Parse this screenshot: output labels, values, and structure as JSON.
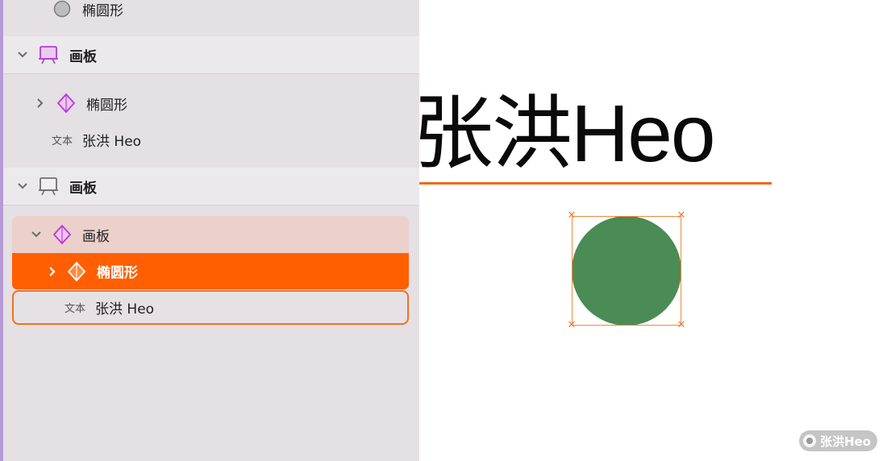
{
  "layers": {
    "top_item": {
      "label": "椭圆形"
    },
    "group1": {
      "label": "画板",
      "children": [
        {
          "label": "椭圆形"
        },
        {
          "type_tag": "文本",
          "label": "张洪 Heo"
        }
      ]
    },
    "group2": {
      "label": "画板",
      "children": [
        {
          "label": "画板"
        },
        {
          "label": "椭圆形"
        },
        {
          "type_tag": "文本",
          "label": "张洪 Heo"
        }
      ]
    }
  },
  "canvas": {
    "text": "张洪Heo",
    "ellipse_color": "#4a8b56",
    "selection_color": "#f06a1e"
  },
  "watermark": {
    "text": "张洪Heo"
  }
}
